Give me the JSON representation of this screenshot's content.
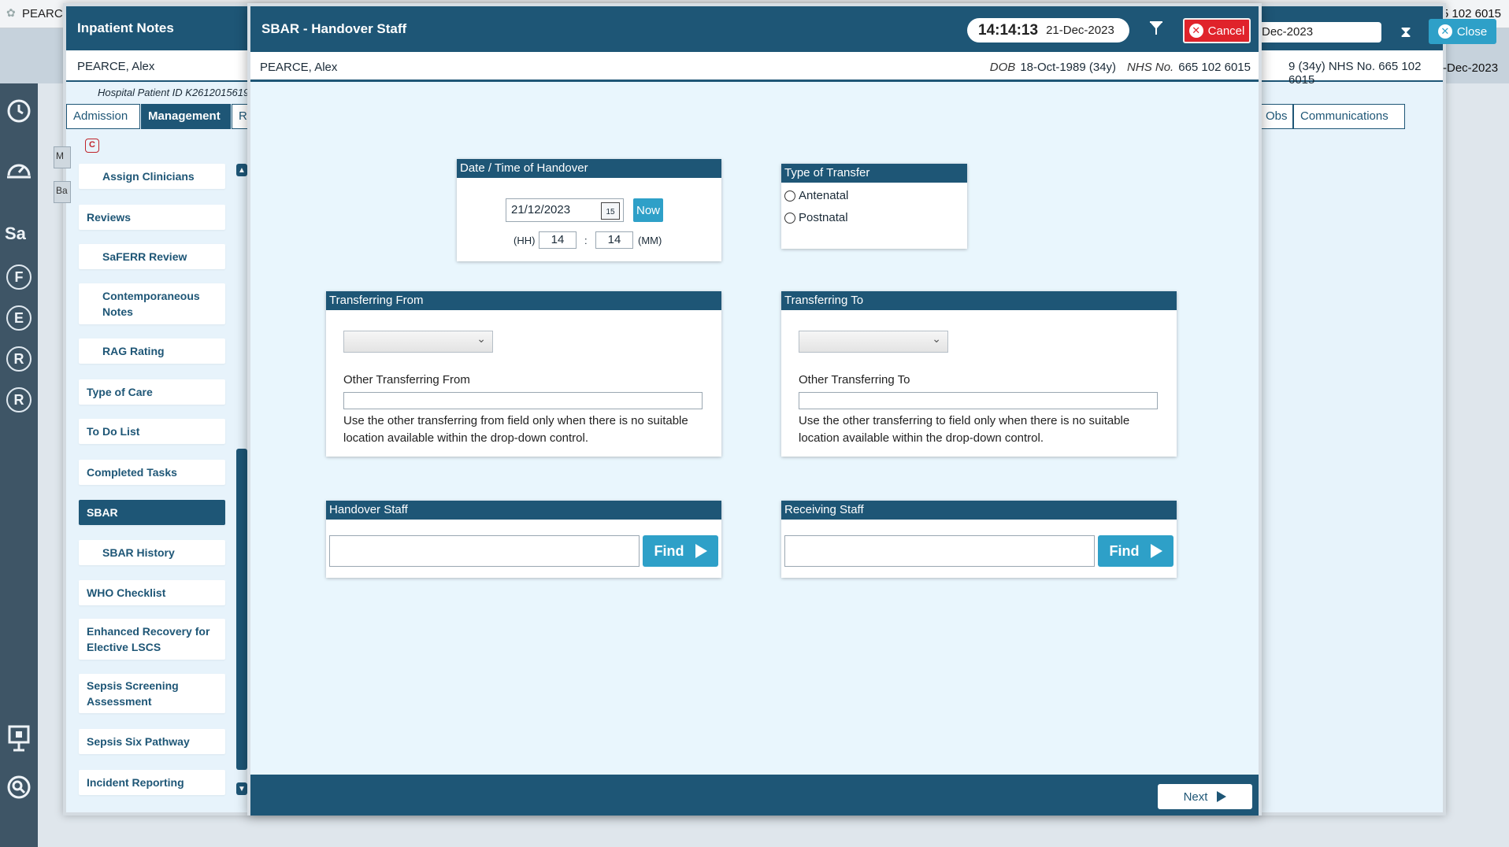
{
  "topbar": {
    "patient_short": "PEARC",
    "nhs_right": "5 102 6015"
  },
  "bg_window": {
    "title": "Inpatient Notes",
    "datetime": "Dec-2023",
    "close_label": "Close",
    "patient_name": "PEARCE, Alex",
    "patient_right": "9 (34y)  NHS No.  665 102 6015",
    "right_date": "-Dec-2023",
    "hospital_id": "Hospital Patient ID  K2612015619",
    "tabs": [
      "Admission",
      "Management",
      "R",
      "Obs",
      "Communications"
    ],
    "side_buttons": [
      "M",
      "Ba"
    ],
    "c_badge": "C"
  },
  "sidebar": {
    "items": [
      {
        "label": "Assign Clinicians",
        "sub": true
      },
      {
        "label": "Reviews",
        "sub": false
      },
      {
        "label": "SaFERR Review",
        "sub": true
      },
      {
        "label": "Contemporaneous Notes",
        "sub": true
      },
      {
        "label": "RAG Rating",
        "sub": true
      },
      {
        "label": "Type of Care",
        "sub": false
      },
      {
        "label": "To Do List",
        "sub": false
      },
      {
        "label": "Completed Tasks",
        "sub": false
      },
      {
        "label": "SBAR",
        "sub": false,
        "active": true
      },
      {
        "label": "SBAR History",
        "sub": true
      },
      {
        "label": "WHO Checklist",
        "sub": false
      },
      {
        "label": "Enhanced Recovery for Elective LSCS",
        "sub": false
      },
      {
        "label": "Sepsis Screening Assessment",
        "sub": false
      },
      {
        "label": "Sepsis Six Pathway",
        "sub": false
      },
      {
        "label": "Incident Reporting",
        "sub": false
      }
    ]
  },
  "rail": {
    "letters": [
      "F",
      "E",
      "R",
      "R"
    ],
    "sa": "Sa"
  },
  "modal": {
    "title": "SBAR - Handover Staff",
    "time": "14:14:13",
    "date": "21-Dec-2023",
    "cancel_label": "Cancel",
    "patient_name": "PEARCE, Alex",
    "dob_label": "DOB",
    "dob_value": "18-Oct-1989 (34y)",
    "nhs_label": "NHS No.",
    "nhs_value": "665 102 6015",
    "handover_dt": {
      "header": "Date / Time of Handover",
      "date_value": "21/12/2023",
      "calendar_day": "15",
      "now_label": "Now",
      "hh_label": "(HH)",
      "hh_value": "14",
      "sep": ":",
      "mm_value": "14",
      "mm_label": "(MM)"
    },
    "transfer_type": {
      "header": "Type of Transfer",
      "options": [
        "Antenatal",
        "Postnatal"
      ]
    },
    "from": {
      "header": "Transferring From",
      "select_value": "",
      "other_label": "Other Transferring From",
      "other_value": "",
      "note": "Use the other transferring from field only when there is no suitable location available within the drop-down control."
    },
    "to": {
      "header": "Transferring To",
      "select_value": "",
      "other_label": "Other Transferring To",
      "other_value": "",
      "note": "Use the other transferring to field only when there is no suitable location available within the drop-down control."
    },
    "handover_staff": {
      "header": "Handover Staff",
      "value": "",
      "find_label": "Find"
    },
    "receiving_staff": {
      "header": "Receiving Staff",
      "value": "",
      "find_label": "Find"
    },
    "next_label": "Next"
  },
  "colors": {
    "primary": "#1e5676",
    "accent": "#2ea0c8",
    "danger": "#e0232b",
    "panel_bg": "#e9f6fd"
  }
}
